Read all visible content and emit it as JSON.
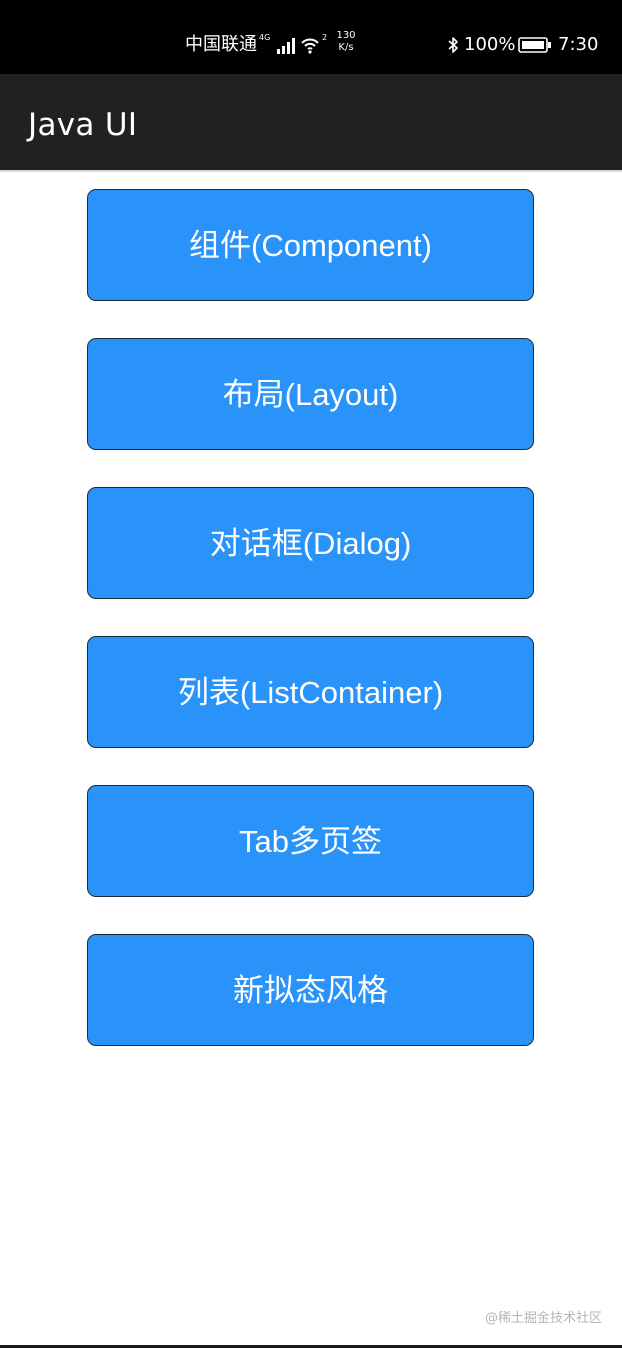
{
  "status_bar": {
    "carrier": "中国联通",
    "network_tag": "4G",
    "wifi_tag": "2",
    "speed_value": "130",
    "speed_unit": "K/s",
    "battery": "100%",
    "time": "7:30",
    "icons": [
      "signal-icon",
      "wifi-icon",
      "bluetooth-icon",
      "battery-icon"
    ]
  },
  "app_bar": {
    "title": "Java UI"
  },
  "menu": {
    "items": [
      {
        "label": "组件(Component)"
      },
      {
        "label": "布局(Layout)"
      },
      {
        "label": "对话框(Dialog)"
      },
      {
        "label": "列表(ListContainer)"
      },
      {
        "label": "Tab多页签"
      },
      {
        "label": "新拟态风格"
      }
    ]
  },
  "watermark": "@稀土掘金技术社区",
  "colors": {
    "button": "#2a93f9",
    "button_border": "#1c2b3a",
    "app_bar": "#212121",
    "status_bar": "#000000"
  }
}
